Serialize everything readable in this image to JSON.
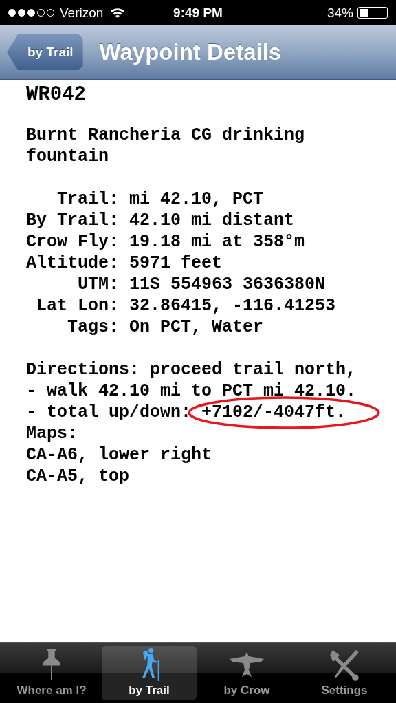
{
  "status_bar": {
    "signal": [
      {
        "on": true
      },
      {
        "on": true
      },
      {
        "on": true
      },
      {
        "on": false
      },
      {
        "on": false
      }
    ],
    "carrier": "Verizon",
    "time": "9:49 PM",
    "battery": "34%",
    "level": 0.34
  },
  "nav_bar": {
    "back": "by Trail",
    "title": "Waypoint Details"
  },
  "waypoint": {
    "code": "WR042",
    "description": "Burnt Rancheria CG drinking fountain",
    "fields": [
      {
        "label": "Trail:",
        "value": "mi 42.10, PCT"
      },
      {
        "label": "By Trail:",
        "value": "42.10 mi distant"
      },
      {
        "label": "Crow Fly:",
        "value": "19.18 mi at 358°m"
      },
      {
        "label": "Altitude:",
        "value": "5971 feet"
      },
      {
        "label": "UTM:",
        "value": "11S 554963 3636380N"
      },
      {
        "label": "Lat Lon:",
        "value": "32.86415, -116.41253"
      },
      {
        "label": "Tags:",
        "value": "On PCT, Water"
      }
    ],
    "directions": [
      {
        "text": "Directions: proceed trail north,"
      },
      {
        "text": "- walk 42.10 mi to PCT mi 42.10."
      },
      {
        "text": "- total up/down:",
        "circled": "+7102/-4047ft."
      },
      {
        "text": "Maps:"
      },
      {
        "text": "CA-A6, lower right"
      },
      {
        "text": "CA-A5, top"
      }
    ]
  },
  "tab_bar": [
    {
      "label": "Where am I?",
      "kind": "pin",
      "selected": false
    },
    {
      "label": "by Trail",
      "kind": "hiker",
      "selected": true
    },
    {
      "label": "by Crow",
      "kind": "bird",
      "selected": false
    },
    {
      "label": "Settings",
      "kind": "tools",
      "selected": false
    }
  ]
}
